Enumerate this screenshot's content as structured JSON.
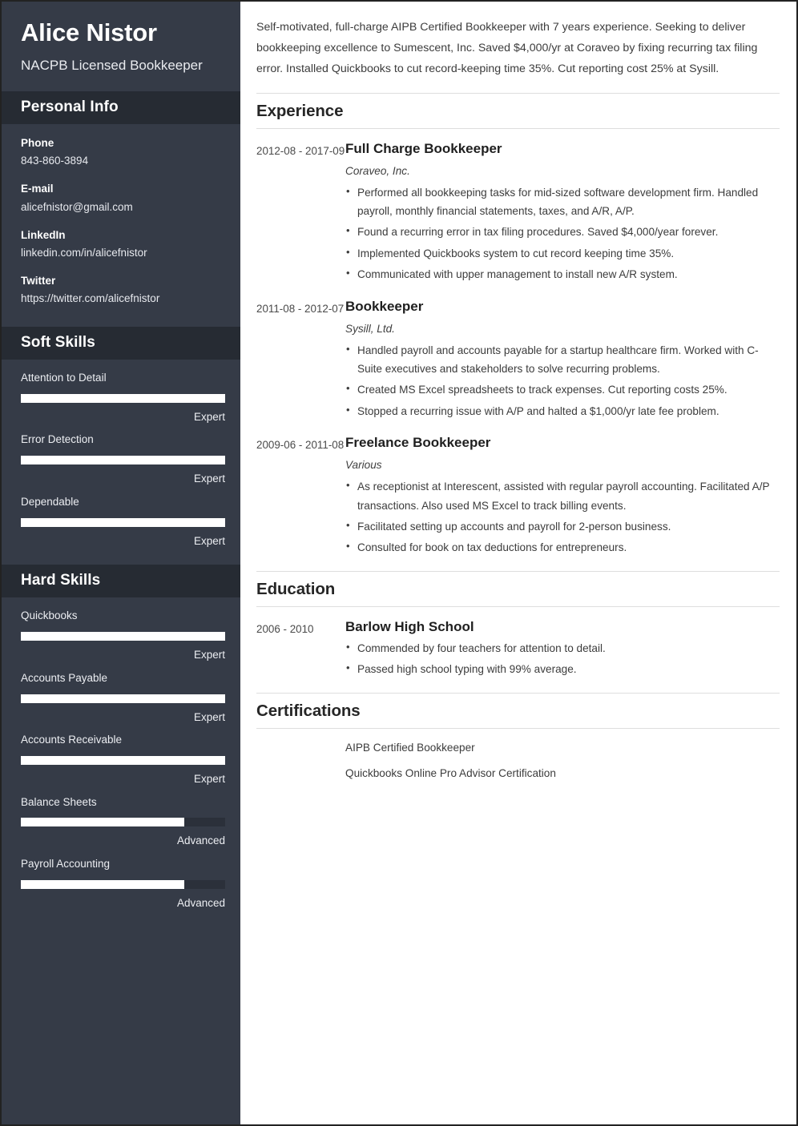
{
  "sidebar": {
    "name": "Alice Nistor",
    "role": "NACPB Licensed Bookkeeper",
    "personal_info": {
      "heading": "Personal Info",
      "items": [
        {
          "label": "Phone",
          "value": "843-860-3894"
        },
        {
          "label": "E-mail",
          "value": "alicefnistor@gmail.com"
        },
        {
          "label": "LinkedIn",
          "value": "linkedin.com/in/alicefnistor"
        },
        {
          "label": "Twitter",
          "value": "https://twitter.com/alicefnistor"
        }
      ]
    },
    "soft_skills": {
      "heading": "Soft Skills",
      "items": [
        {
          "name": "Attention to Detail",
          "level": "Expert",
          "percent": 100
        },
        {
          "name": "Error Detection",
          "level": "Expert",
          "percent": 100
        },
        {
          "name": "Dependable",
          "level": "Expert",
          "percent": 100
        }
      ]
    },
    "hard_skills": {
      "heading": "Hard Skills",
      "items": [
        {
          "name": "Quickbooks",
          "level": "Expert",
          "percent": 100
        },
        {
          "name": "Accounts Payable",
          "level": "Expert",
          "percent": 100
        },
        {
          "name": "Accounts Receivable",
          "level": "Expert",
          "percent": 100
        },
        {
          "name": "Balance Sheets",
          "level": "Advanced",
          "percent": 80
        },
        {
          "name": "Payroll Accounting",
          "level": "Advanced",
          "percent": 80
        }
      ]
    }
  },
  "main": {
    "summary": "Self-motivated, full-charge AIPB Certified Bookkeeper with 7 years experience. Seeking to deliver bookkeeping excellence to Sumescent, Inc. Saved $4,000/yr at Coraveo by fixing recurring tax filing error. Installed Quickbooks to cut record-keeping time 35%. Cut reporting cost 25% at Sysill.",
    "experience": {
      "heading": "Experience",
      "entries": [
        {
          "dates": "2012-08 - 2017-09",
          "title": "Full Charge Bookkeeper",
          "org": "Coraveo, Inc.",
          "bullets": [
            "Performed all bookkeeping tasks for mid-sized software development firm. Handled payroll, monthly financial statements, taxes, and A/R, A/P.",
            "Found a recurring error in tax filing procedures. Saved $4,000/year forever.",
            "Implemented Quickbooks system to cut record keeping time 35%.",
            "Communicated with upper management to install new A/R system."
          ]
        },
        {
          "dates": "2011-08 - 2012-07",
          "title": "Bookkeeper",
          "org": "Sysill, Ltd.",
          "bullets": [
            "Handled payroll and accounts payable for a startup healthcare firm. Worked with C-Suite executives and stakeholders to solve recurring problems.",
            "Created MS Excel spreadsheets to track expenses. Cut reporting costs 25%.",
            "Stopped a recurring issue with A/P and halted a $1,000/yr late fee problem."
          ]
        },
        {
          "dates": "2009-06 - 2011-08",
          "title": "Freelance Bookkeeper",
          "org": "Various",
          "bullets": [
            "As receptionist at Interescent, assisted with regular payroll accounting. Facilitated A/P transactions. Also used MS Excel to track billing events.",
            "Facilitated setting up accounts and payroll for 2-person business.",
            "Consulted for book on tax deductions for entrepreneurs."
          ]
        }
      ]
    },
    "education": {
      "heading": "Education",
      "entries": [
        {
          "dates": "2006 - 2010",
          "title": "Barlow High School",
          "bullets": [
            "Commended by four teachers for attention to detail.",
            "Passed high school typing with 99% average."
          ]
        }
      ]
    },
    "certifications": {
      "heading": "Certifications",
      "items": [
        "AIPB Certified Bookkeeper",
        "Quickbooks Online Pro Advisor Certification"
      ]
    }
  }
}
